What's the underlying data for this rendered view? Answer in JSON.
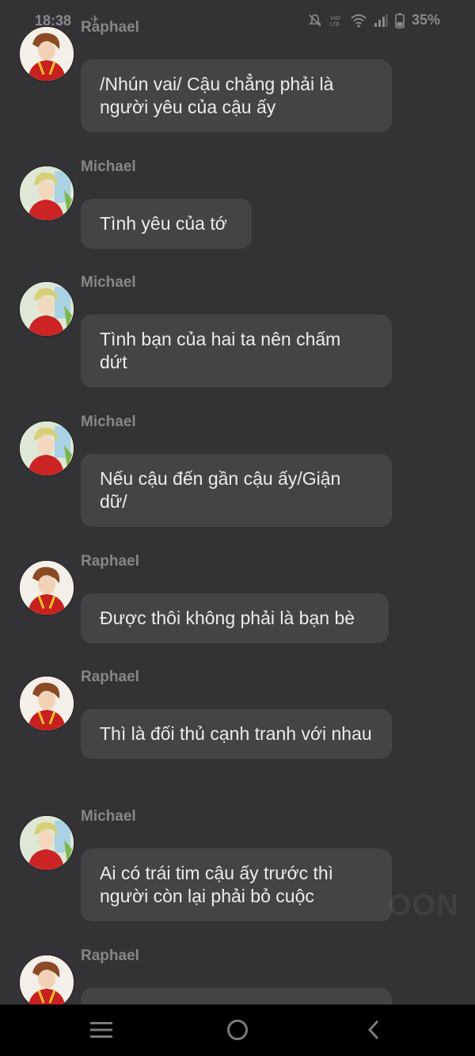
{
  "status_bar": {
    "time": "18:38",
    "notification_icon": "app-notification-icon",
    "icons": [
      "mute-bell-icon",
      "volte-icon",
      "wifi-icon",
      "signal-icon",
      "battery-icon"
    ],
    "battery": "35%"
  },
  "messages": [
    {
      "sender": "Raphael",
      "avatar": "raphael-avatar",
      "text": "/Nhún vai/ Cậu chẳng phải là người yêu của cậu ấy"
    },
    {
      "sender": "Michael",
      "avatar": "michael-avatar",
      "text": "Tình yêu của tớ"
    },
    {
      "sender": "Michael",
      "avatar": "michael-avatar",
      "text": "Tình bạn của hai ta nên chấm dứt"
    },
    {
      "sender": "Michael",
      "avatar": "michael-avatar",
      "text": "Nếu cậu đến gần cậu ấy/Giận dữ/"
    },
    {
      "sender": "Raphael",
      "avatar": "raphael-avatar",
      "text": "Được thôi không phải là bạn bè"
    },
    {
      "sender": "Raphael",
      "avatar": "raphael-avatar",
      "text": "Thì là đối thủ cạnh tranh với nhau"
    },
    {
      "sender": "Michael",
      "avatar": "michael-avatar",
      "text": "Ai có trái tim cậu ấy trước thì người còn lại phải bỏ cuộc"
    },
    {
      "sender": "Raphael",
      "avatar": "raphael-avatar",
      "text": ""
    }
  ],
  "watermark": "OON",
  "nav_bar": {
    "buttons": [
      "menu-icon",
      "home-icon",
      "back-icon"
    ]
  },
  "colors": {
    "background": "#333335",
    "bubble": "#444447",
    "sender_text": "#87878a",
    "message_text": "#ececec",
    "nav_bar": "#000000"
  }
}
